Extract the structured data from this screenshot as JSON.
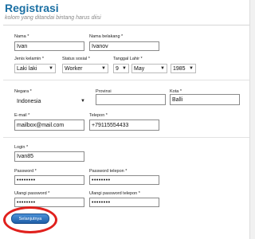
{
  "header": {
    "title": "Registrasi",
    "subtitle": "kolom yang ditandai bintang harus diisi"
  },
  "fields": {
    "first_name": {
      "label": "Nama *",
      "value": "Ivan"
    },
    "last_name": {
      "label": "Nama belakang *",
      "value": "Ivanov"
    },
    "gender": {
      "label": "Jenis kelamin *",
      "value": "Laki laki"
    },
    "social_status": {
      "label": "Status sosial *",
      "value": "Worker"
    },
    "birth_date": {
      "label": "Tanggal Lahir *",
      "day": "9",
      "month": "May",
      "year": "1985"
    },
    "country": {
      "label": "Negara *",
      "value": "Indonesia"
    },
    "province": {
      "label": "Provinsi",
      "value": ""
    },
    "city": {
      "label": "Kota *",
      "value": "Balli"
    },
    "email": {
      "label": "E-mail *",
      "value": "mailbox@mail.com"
    },
    "phone": {
      "label": "Telepon *",
      "value": "+79115554433"
    },
    "login": {
      "label": "Login *",
      "value": "Ivan85"
    },
    "password": {
      "label": "Password *",
      "value": "••••••••"
    },
    "phone_password": {
      "label": "Password telepon *",
      "value": "••••••••"
    },
    "password_repeat": {
      "label": "Ulangi password *",
      "value": "••••••••"
    },
    "phone_password_repeat": {
      "label": "Ulangi password telepon *",
      "value": "••••••••"
    }
  },
  "submit": {
    "label": "Selanjutnya"
  },
  "colors": {
    "accent": "#1a6fa3",
    "button": "#2a6fbf",
    "highlight_circle": "#e0201c"
  }
}
